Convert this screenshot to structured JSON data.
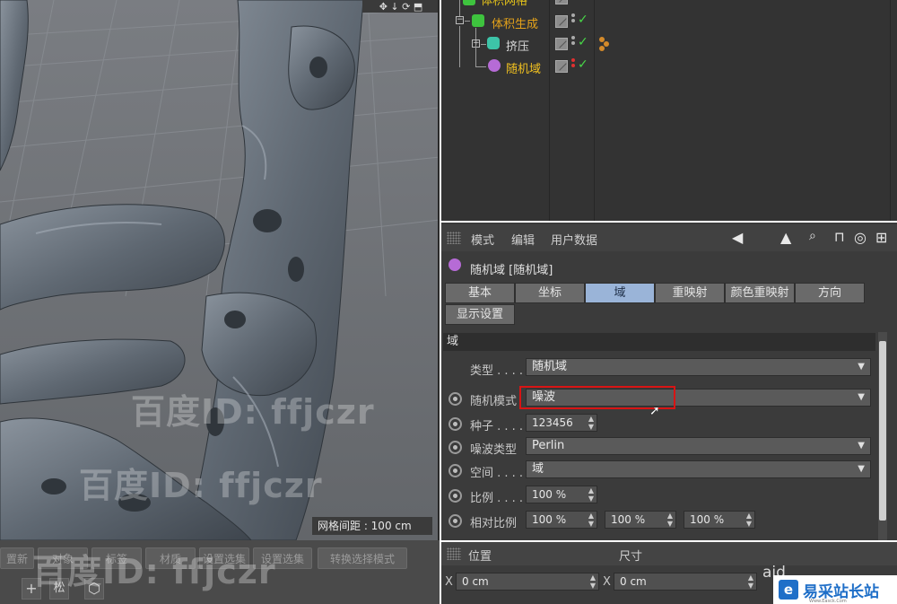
{
  "viewport": {
    "nav_glyphs": "✥ ↓ ⟳ ⬒",
    "grid_spacing_label": "网格间距 : 100 cm"
  },
  "bottom_toolbar": {
    "buttons": [
      "置新",
      "对象",
      "标签",
      "材质",
      "设置选集",
      "转换选择模式"
    ],
    "icons": [
      "+",
      "松",
      "⬡"
    ]
  },
  "object_manager": {
    "objects": [
      {
        "name": "体积网格",
        "color": "#e4c21a",
        "depth": 0
      },
      {
        "name": "体积生成",
        "color": "#e4a21a",
        "depth": 1
      },
      {
        "name": "挤压",
        "color": "#d8d8d8",
        "depth": 2
      },
      {
        "name": "随机域",
        "color": "#f0c020",
        "depth": 2
      }
    ]
  },
  "attribute_manager": {
    "menu": [
      "模式",
      "编辑",
      "用户数据"
    ],
    "toolbar_icons": [
      "◀",
      "▲",
      "🔍",
      "🔓",
      "◎",
      "⊞"
    ],
    "object_title": "随机域 [随机域]",
    "tabs": [
      "基本",
      "坐标",
      "域",
      "重映射",
      "颜色重映射",
      "方向",
      "显示设置"
    ],
    "active_tab": "域",
    "section_header": "域",
    "properties": {
      "type_label": "类型 . . . .",
      "type_value": "随机域",
      "random_mode_label": "随机模式",
      "random_mode_value": "噪波",
      "seed_label": "种子 . . . .",
      "seed_value": "123456",
      "noise_type_label": "噪波类型",
      "noise_type_value": "Perlin",
      "space_label": "空间 . . . .",
      "space_value": "域",
      "scale_label": "比例 . . . .",
      "scale_value": "100 %",
      "relative_scale_label": "相对比例",
      "relative_scale_values": [
        "100 %",
        "100 %",
        "100 %"
      ]
    }
  },
  "coordinate_manager": {
    "position_label": "位置",
    "size_label": "尺寸",
    "x_label": "X",
    "x_pos": "0 cm",
    "x_size": "0 cm",
    "extra_text": "aid"
  },
  "watermarks": {
    "baidu_1": "百度ID: ffjczr",
    "baidu_2": "百度ID: ffjczr",
    "baidu_3": "百度ID: ffjczr",
    "site_logo": "易采站长站",
    "site_logo_mark": "e",
    "site_sub": "Www.Easck.Com"
  },
  "colors": {
    "accent_tab": "#9ab4d8",
    "highlight": "#d81414",
    "check": "#48d848"
  }
}
